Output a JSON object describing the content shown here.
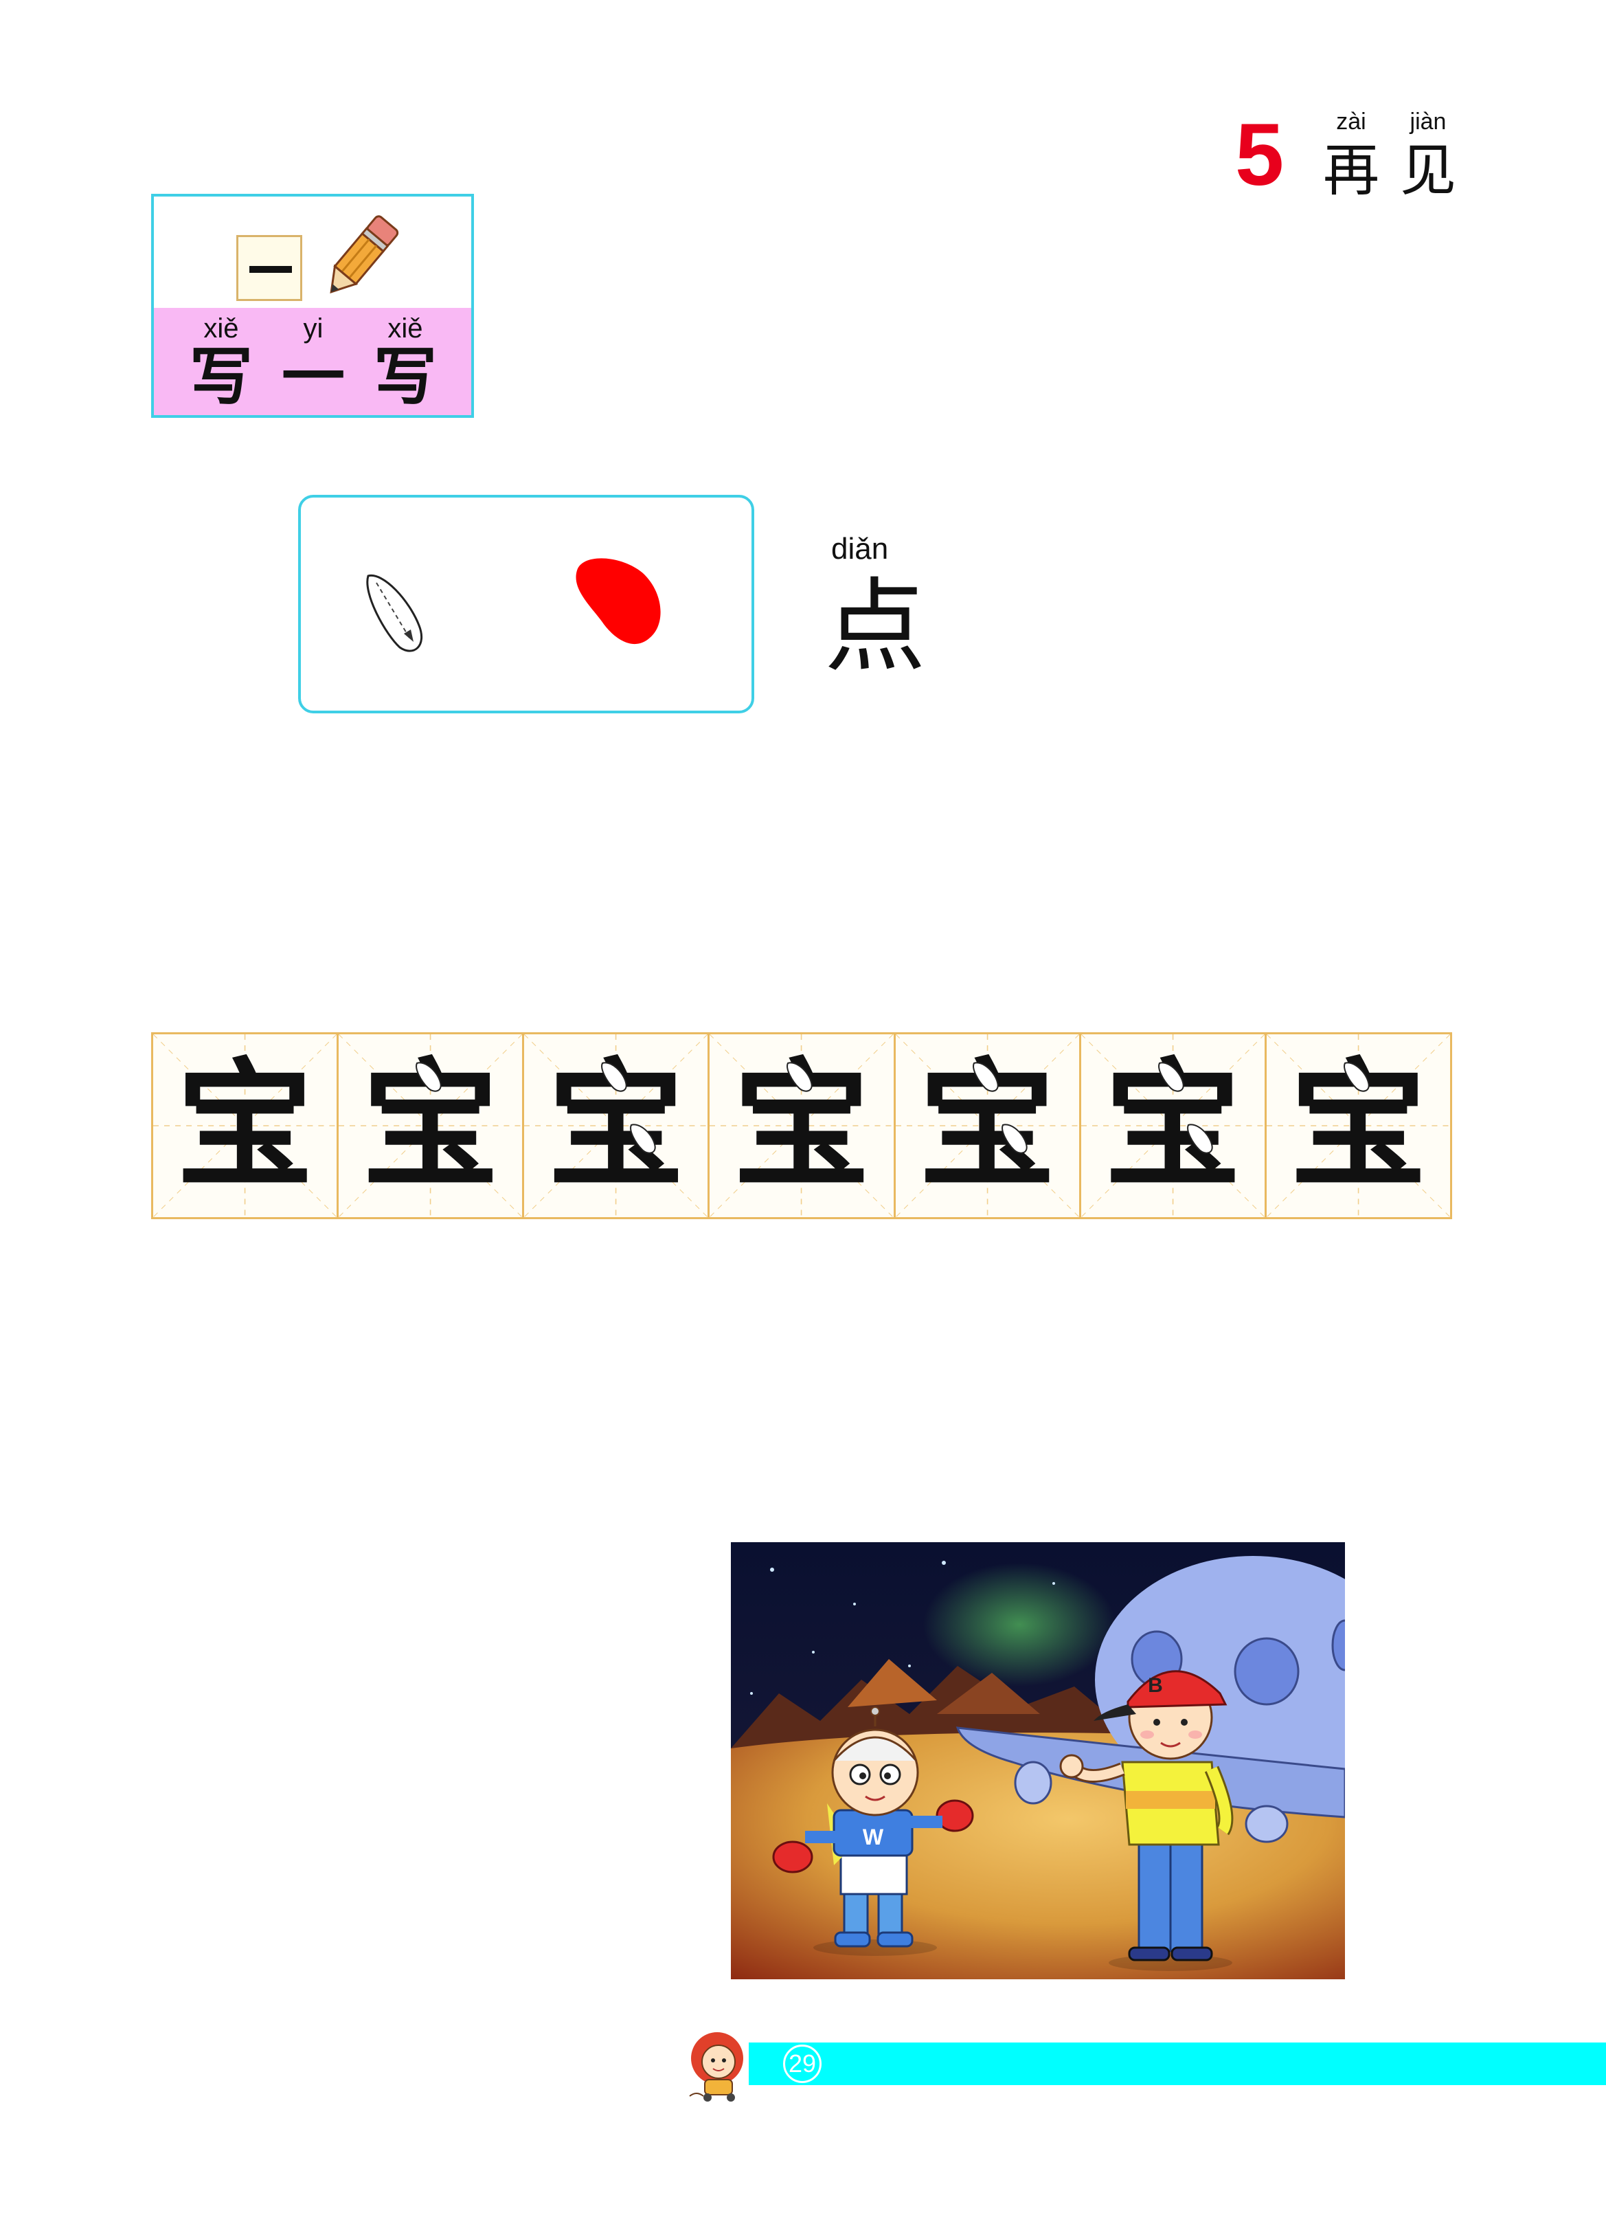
{
  "lesson": {
    "number": "5",
    "title": [
      {
        "pinyin": "zài",
        "hanzi": "再"
      },
      {
        "pinyin": "jiàn",
        "hanzi": "见"
      }
    ]
  },
  "write_section": {
    "sample_stroke": "一",
    "columns": [
      {
        "pinyin": "xiě",
        "hanzi": "写"
      },
      {
        "pinyin": "yi",
        "hanzi": "一"
      },
      {
        "pinyin": "xiě",
        "hanzi": "写"
      }
    ]
  },
  "stroke": {
    "pinyin": "diǎn",
    "hanzi": "点"
  },
  "practice": {
    "characters": [
      "宝",
      "宝",
      "宝",
      "宝",
      "宝",
      "宝",
      "宝"
    ]
  },
  "illustration": {
    "child_shirt_letter": "W",
    "child_cap_letter": "B"
  },
  "footer": {
    "page_number": "29"
  },
  "colors": {
    "lesson_number": "#e8001c",
    "box_border": "#3fcfe6",
    "pink_band": "#f9b9f4",
    "grid_border": "#e9b960",
    "stroke_fill": "#ff0000",
    "footer_bar": "#00ffff"
  }
}
